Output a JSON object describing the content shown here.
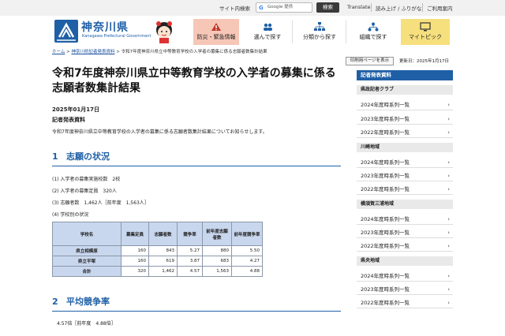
{
  "utility": {
    "label": "サイト内検索",
    "search_placeholder": "Google 提供",
    "search_button": "検索",
    "translate": "Translate",
    "furigana": "読み上げ / ふりがな",
    "usage": "ご利用案内"
  },
  "header": {
    "logo_name": "神奈川県",
    "logo_sub": "Kanagawa Prefectural Government",
    "nav": [
      {
        "label": "防災・緊急情報"
      },
      {
        "label": "選んで探す"
      },
      {
        "label": "分類から探す"
      },
      {
        "label": "組織で探す"
      },
      {
        "label": "マイトピック"
      }
    ]
  },
  "breadcrumb": {
    "home": "ホーム",
    "sep1": ">",
    "parent": "神奈川県記者発表資料",
    "sep2": ">",
    "current": "令和7年度神奈川県立中等教育学校の入学者の募集に係る志願者数集計結果"
  },
  "main": {
    "title": "令和7年度神奈川県立中等教育学校の入学者の募集に係る志願者数集計結果",
    "date": "2025年01月17日",
    "type": "記者発表資料",
    "intro": "令和7年度神奈川県立中等教育学校の入学者の募集に係る志願者数集計結果についてお知らせします。",
    "section1": {
      "num": "1",
      "title": "志願の状況"
    },
    "items": [
      "(1) 入学者の募集実施校数　2校",
      "(2) 入学者の募集定員　320人",
      "(3) 志願者数　1,462人［前年度　1,563人］",
      "(4) 学校別の状況"
    ],
    "table": {
      "headers": [
        "学校名",
        "募集定員",
        "志願者数",
        "競争率",
        "前年度志願者数",
        "前年度競争率"
      ],
      "rows": [
        [
          "県立相模原",
          "160",
          "843",
          "5.27",
          "880",
          "5.50"
        ],
        [
          "県立平塚",
          "160",
          "619",
          "3.87",
          "683",
          "4.27"
        ],
        [
          "合計",
          "320",
          "1,462",
          "4.57",
          "1,563",
          "4.88"
        ]
      ]
    },
    "section2": {
      "num": "2",
      "title": "平均競争率"
    },
    "avg": "4.57倍［前年度　4.88倍］"
  },
  "sidebar": {
    "print": "印刷用ページを表示",
    "updated": "更新日：2025年1月17日",
    "head": "記者発表資料",
    "groups": [
      {
        "name": "県政記者クラブ",
        "items": [
          "2024年度時系列一覧",
          "2023年度時系列一覧",
          "2022年度時系列一覧"
        ]
      },
      {
        "name": "川崎地域",
        "items": [
          "2024年度時系列一覧",
          "2023年度時系列一覧",
          "2022年度時系列一覧"
        ]
      },
      {
        "name": "横須賀三浦地域",
        "items": [
          "2024年度時系列一覧",
          "2023年度時系列一覧",
          "2022年度時系列一覧"
        ]
      },
      {
        "name": "県央地域",
        "items": [
          "2024年度時系列一覧",
          "2023年度時系列一覧",
          "2022年度時系列一覧"
        ]
      }
    ]
  }
}
